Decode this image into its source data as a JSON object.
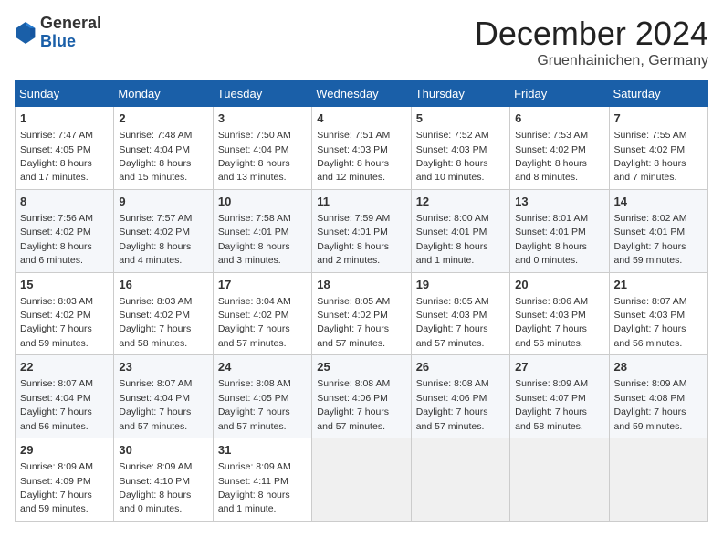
{
  "header": {
    "logo": {
      "line1": "General",
      "line2": "Blue"
    },
    "title": "December 2024",
    "location": "Gruenhainichen, Germany"
  },
  "weekdays": [
    "Sunday",
    "Monday",
    "Tuesday",
    "Wednesday",
    "Thursday",
    "Friday",
    "Saturday"
  ],
  "weeks": [
    [
      {
        "day": 1,
        "info": "Sunrise: 7:47 AM\nSunset: 4:05 PM\nDaylight: 8 hours and 17 minutes."
      },
      {
        "day": 2,
        "info": "Sunrise: 7:48 AM\nSunset: 4:04 PM\nDaylight: 8 hours and 15 minutes."
      },
      {
        "day": 3,
        "info": "Sunrise: 7:50 AM\nSunset: 4:04 PM\nDaylight: 8 hours and 13 minutes."
      },
      {
        "day": 4,
        "info": "Sunrise: 7:51 AM\nSunset: 4:03 PM\nDaylight: 8 hours and 12 minutes."
      },
      {
        "day": 5,
        "info": "Sunrise: 7:52 AM\nSunset: 4:03 PM\nDaylight: 8 hours and 10 minutes."
      },
      {
        "day": 6,
        "info": "Sunrise: 7:53 AM\nSunset: 4:02 PM\nDaylight: 8 hours and 8 minutes."
      },
      {
        "day": 7,
        "info": "Sunrise: 7:55 AM\nSunset: 4:02 PM\nDaylight: 8 hours and 7 minutes."
      }
    ],
    [
      {
        "day": 8,
        "info": "Sunrise: 7:56 AM\nSunset: 4:02 PM\nDaylight: 8 hours and 6 minutes."
      },
      {
        "day": 9,
        "info": "Sunrise: 7:57 AM\nSunset: 4:02 PM\nDaylight: 8 hours and 4 minutes."
      },
      {
        "day": 10,
        "info": "Sunrise: 7:58 AM\nSunset: 4:01 PM\nDaylight: 8 hours and 3 minutes."
      },
      {
        "day": 11,
        "info": "Sunrise: 7:59 AM\nSunset: 4:01 PM\nDaylight: 8 hours and 2 minutes."
      },
      {
        "day": 12,
        "info": "Sunrise: 8:00 AM\nSunset: 4:01 PM\nDaylight: 8 hours and 1 minute."
      },
      {
        "day": 13,
        "info": "Sunrise: 8:01 AM\nSunset: 4:01 PM\nDaylight: 8 hours and 0 minutes."
      },
      {
        "day": 14,
        "info": "Sunrise: 8:02 AM\nSunset: 4:01 PM\nDaylight: 7 hours and 59 minutes."
      }
    ],
    [
      {
        "day": 15,
        "info": "Sunrise: 8:03 AM\nSunset: 4:02 PM\nDaylight: 7 hours and 59 minutes."
      },
      {
        "day": 16,
        "info": "Sunrise: 8:03 AM\nSunset: 4:02 PM\nDaylight: 7 hours and 58 minutes."
      },
      {
        "day": 17,
        "info": "Sunrise: 8:04 AM\nSunset: 4:02 PM\nDaylight: 7 hours and 57 minutes."
      },
      {
        "day": 18,
        "info": "Sunrise: 8:05 AM\nSunset: 4:02 PM\nDaylight: 7 hours and 57 minutes."
      },
      {
        "day": 19,
        "info": "Sunrise: 8:05 AM\nSunset: 4:03 PM\nDaylight: 7 hours and 57 minutes."
      },
      {
        "day": 20,
        "info": "Sunrise: 8:06 AM\nSunset: 4:03 PM\nDaylight: 7 hours and 56 minutes."
      },
      {
        "day": 21,
        "info": "Sunrise: 8:07 AM\nSunset: 4:03 PM\nDaylight: 7 hours and 56 minutes."
      }
    ],
    [
      {
        "day": 22,
        "info": "Sunrise: 8:07 AM\nSunset: 4:04 PM\nDaylight: 7 hours and 56 minutes."
      },
      {
        "day": 23,
        "info": "Sunrise: 8:07 AM\nSunset: 4:04 PM\nDaylight: 7 hours and 57 minutes."
      },
      {
        "day": 24,
        "info": "Sunrise: 8:08 AM\nSunset: 4:05 PM\nDaylight: 7 hours and 57 minutes."
      },
      {
        "day": 25,
        "info": "Sunrise: 8:08 AM\nSunset: 4:06 PM\nDaylight: 7 hours and 57 minutes."
      },
      {
        "day": 26,
        "info": "Sunrise: 8:08 AM\nSunset: 4:06 PM\nDaylight: 7 hours and 57 minutes."
      },
      {
        "day": 27,
        "info": "Sunrise: 8:09 AM\nSunset: 4:07 PM\nDaylight: 7 hours and 58 minutes."
      },
      {
        "day": 28,
        "info": "Sunrise: 8:09 AM\nSunset: 4:08 PM\nDaylight: 7 hours and 59 minutes."
      }
    ],
    [
      {
        "day": 29,
        "info": "Sunrise: 8:09 AM\nSunset: 4:09 PM\nDaylight: 7 hours and 59 minutes."
      },
      {
        "day": 30,
        "info": "Sunrise: 8:09 AM\nSunset: 4:10 PM\nDaylight: 8 hours and 0 minutes."
      },
      {
        "day": 31,
        "info": "Sunrise: 8:09 AM\nSunset: 4:11 PM\nDaylight: 8 hours and 1 minute."
      },
      null,
      null,
      null,
      null
    ]
  ]
}
